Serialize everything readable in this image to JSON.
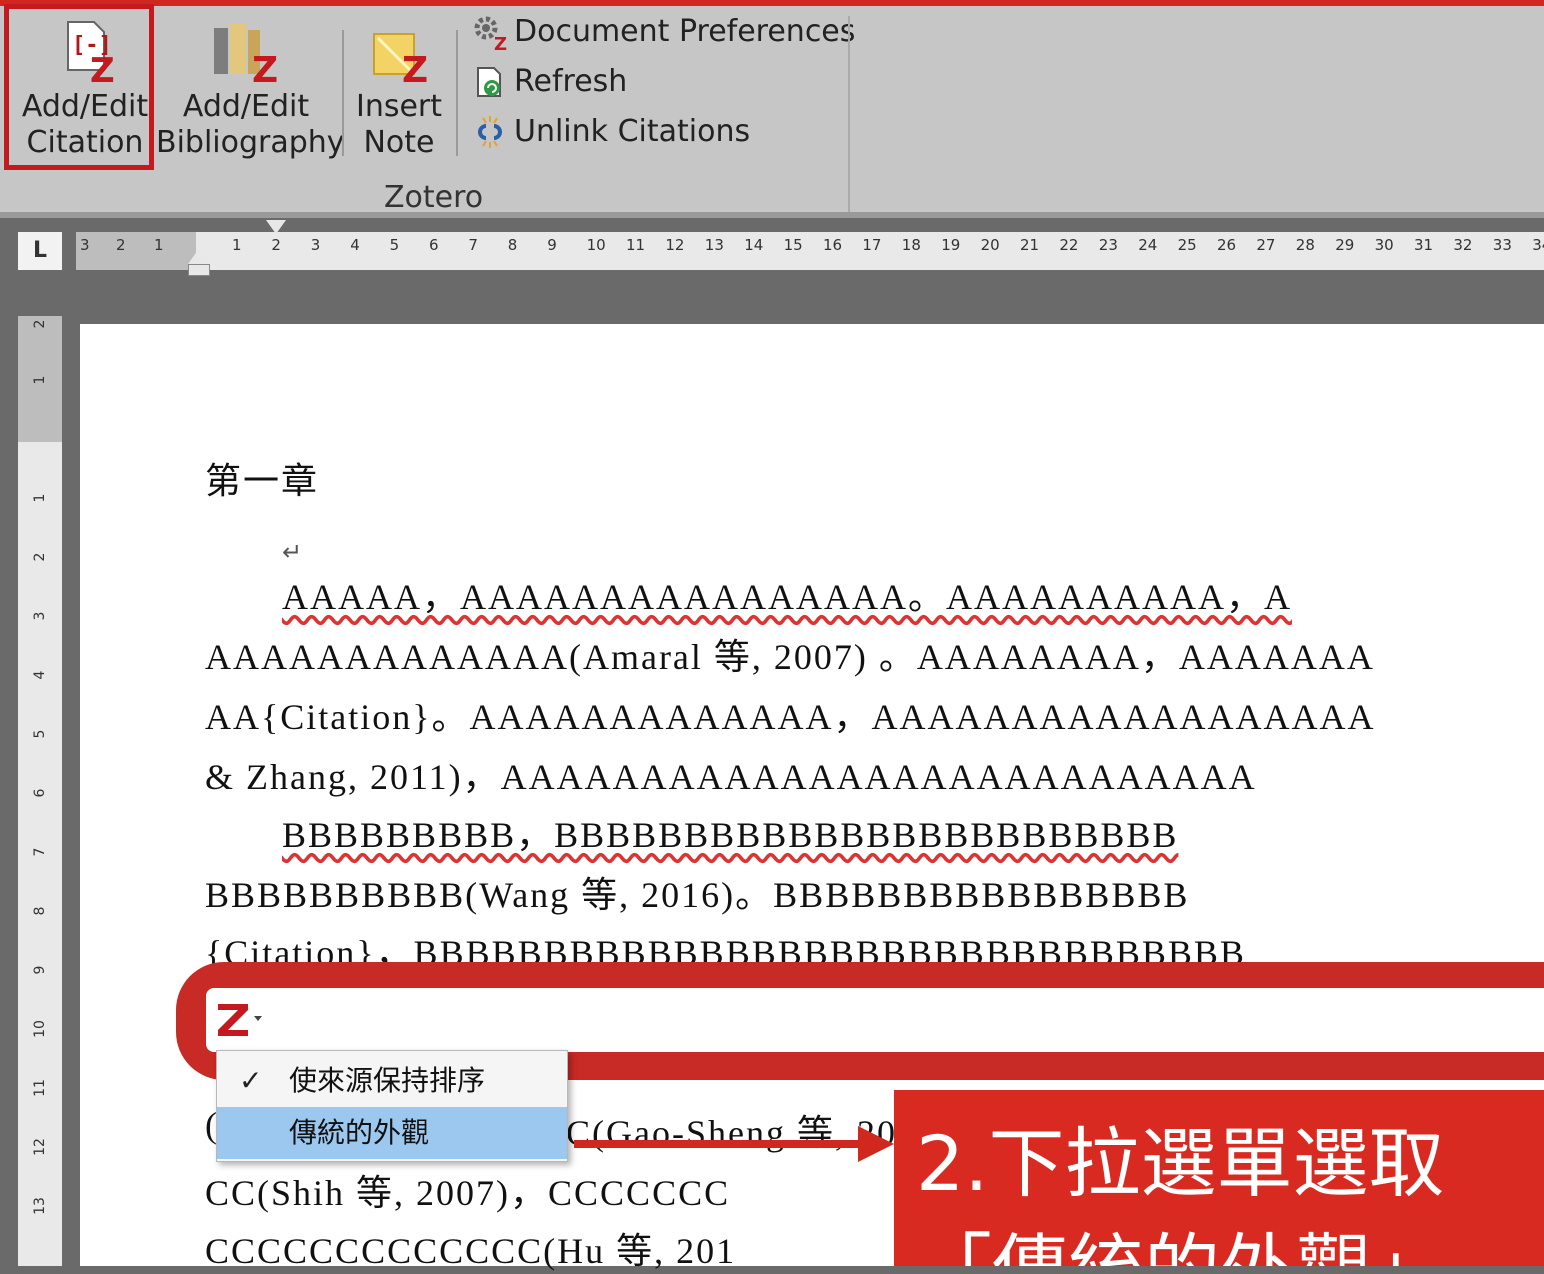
{
  "ribbon": {
    "add_edit_citation": [
      "Add/Edit",
      "Citation"
    ],
    "add_edit_bibliography": [
      "Add/Edit",
      "Bibliography"
    ],
    "insert_note": [
      "Insert",
      "Note"
    ],
    "document_preferences": "Document Preferences",
    "refresh": "Refresh",
    "unlink_citations": "Unlink Citations",
    "group_label": "Zotero"
  },
  "ruler": {
    "tab_selector": "L",
    "left_labels": [
      "3",
      "2",
      "1"
    ],
    "labels": [
      "1",
      "2",
      "3",
      "4",
      "5",
      "6",
      "7",
      "8",
      "9",
      "10",
      "11",
      "12",
      "13",
      "14",
      "15",
      "16",
      "17",
      "18",
      "19",
      "20",
      "21",
      "22",
      "23",
      "24",
      "25",
      "26",
      "27",
      "28",
      "29",
      "30",
      "31",
      "32",
      "33",
      "34"
    ],
    "vertical_labels": [
      "2",
      "1",
      "1",
      "2",
      "3",
      "4",
      "5",
      "6",
      "7",
      "8",
      "9",
      "10",
      "11",
      "12",
      "13"
    ]
  },
  "document": {
    "heading": "第一章",
    "empty_paragraph": "↵",
    "line1": "AAAAA，AAAAAAAAAAAAAAAA。AAAAAAAAAA，A",
    "line2": "AAAAAAAAAAAAA(Amaral 等, 2007) 。AAAAAAAA，AAAAAAA",
    "line3": "AA{Citation}。AAAAAAAAAAAAA，AAAAAAAAAAAAAAAAAA",
    "line4": "& Zhang, 2011)，AAAAAAAAAAAAAAAAAAAAAAAAAAA",
    "line5": "BBBBBBBBB，BBBBBBBBBBBBBBBBBBBBBBBB",
    "line6": "BBBBBBBBBB(Wang 等, 2016)。BBBBBBBBBBBBBBBB",
    "line7": "{Citation}，BBBBBBBBBBBBBBBBBBBBBBBBBBBBBBBB",
    "line8_partial": "C(Gao-Sheng 等, 20",
    "line8_lead": "(",
    "line9": "CC(Shih 等, 2007)，CCCCCCC",
    "line10": "CCCCCCCCCCCCC(Hu 等, 201"
  },
  "zotero_bar": {
    "menu_items": [
      {
        "label": "使來源保持排序",
        "checked": true
      },
      {
        "label": "傳統的外觀",
        "checked": false
      }
    ]
  },
  "callout": {
    "line1": "2.下拉選單選取",
    "line2": "「傳統的外觀」"
  },
  "colors": {
    "accent_red": "#d0281f",
    "menu_highlight": "#9cc8ef"
  }
}
